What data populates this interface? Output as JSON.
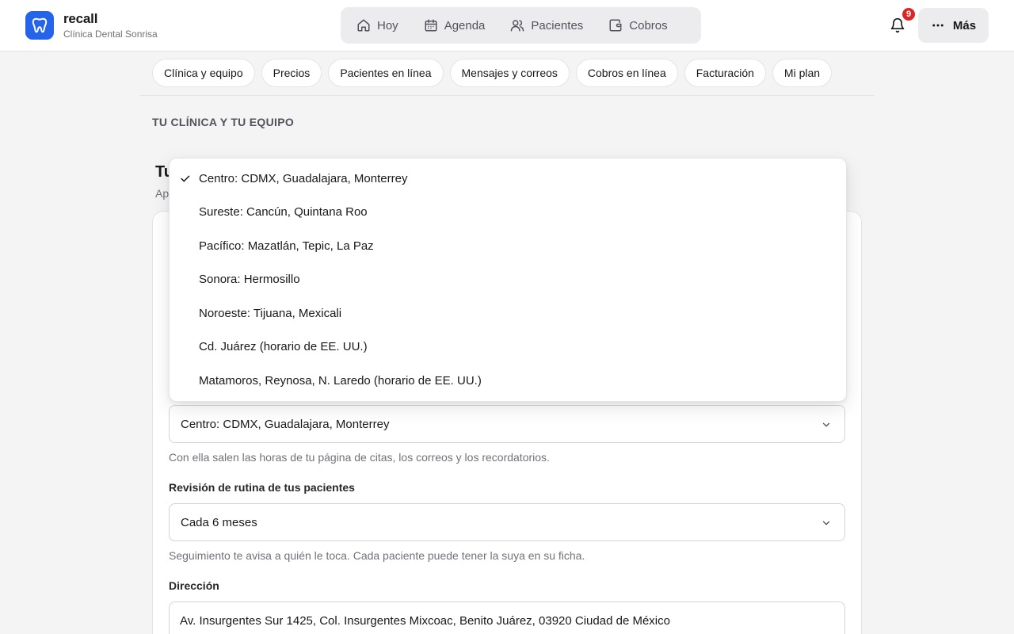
{
  "brand": {
    "name": "recall",
    "subtitle": "Clínica Dental Sonrisa",
    "logo_icon": "tooth-icon",
    "color": "#2563eb"
  },
  "nav": {
    "items": [
      {
        "label": "Hoy",
        "icon": "home-icon"
      },
      {
        "label": "Agenda",
        "icon": "calendar-icon"
      },
      {
        "label": "Pacientes",
        "icon": "users-icon"
      },
      {
        "label": "Cobros",
        "icon": "wallet-icon"
      }
    ]
  },
  "notifications": {
    "count": "9",
    "icon": "bell-icon",
    "badge_color": "#dc2626"
  },
  "more": {
    "label": "Más",
    "icon": "ellipsis-icon"
  },
  "settings_tabs": [
    "Clínica y equipo",
    "Precios",
    "Pacientes en línea",
    "Mensajes y correos",
    "Cobros en línea",
    "Facturación",
    "Mi plan"
  ],
  "section": {
    "label": "TU CLÍNICA Y TU EQUIPO",
    "card_title": "Tu",
    "card_subtitle": "Ap"
  },
  "timezone": {
    "value": "Centro: CDMX, Guadalajara, Monterrey",
    "help": "Con ella salen las horas de tu página de citas, los correos y los recordatorios.",
    "options": [
      "Centro: CDMX, Guadalajara, Monterrey",
      "Sureste: Cancún, Quintana Roo",
      "Pacífico: Mazatlán, Tepic, La Paz",
      "Sonora: Hermosillo",
      "Noroeste: Tijuana, Mexicali",
      "Cd. Juárez (horario de EE. UU.)",
      "Matamoros, Reynosa, N. Laredo (horario de EE. UU.)"
    ]
  },
  "recall_interval": {
    "label": "Revisión de rutina de tus pacientes",
    "value": "Cada 6 meses",
    "help": "Seguimiento te avisa a quién le toca. Cada paciente puede tener la suya en su ficha."
  },
  "address": {
    "label": "Dirección",
    "value": "Av. Insurgentes Sur 1425, Col. Insurgentes Mixcoac, Benito Juárez, 03920 Ciudad de México"
  }
}
